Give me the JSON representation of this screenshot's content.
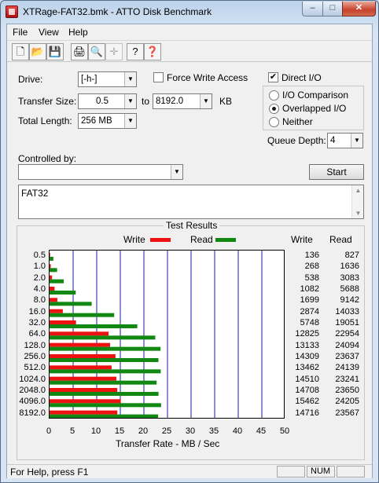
{
  "window": {
    "title": "XTRage-FAT32.bmk - ATTO Disk Benchmark",
    "min": "–",
    "max": "□",
    "close": "✕"
  },
  "menu": [
    "File",
    "View",
    "Help"
  ],
  "toolbar": [
    {
      "icon": "new-file-icon",
      "glyph": "🗋"
    },
    {
      "icon": "open-folder-icon",
      "glyph": "📂"
    },
    {
      "icon": "save-icon",
      "glyph": "💾"
    },
    {
      "icon": "print-icon",
      "glyph": "🖨"
    },
    {
      "icon": "print-preview-icon",
      "glyph": "🔍"
    },
    {
      "icon": "move-icon",
      "glyph": "✛"
    },
    {
      "icon": "help-icon",
      "glyph": "?"
    },
    {
      "icon": "context-help-icon",
      "glyph": "❓"
    }
  ],
  "form": {
    "drive_label": "Drive:",
    "drive_value": "[-h-]",
    "force_write_label": "Force Write Access",
    "force_write_checked": false,
    "direct_io_label": "Direct I/O",
    "direct_io_checked": true,
    "transfer_label": "Transfer Size:",
    "transfer_from": "0.5",
    "to_label": "to",
    "transfer_to": "8192.0",
    "kb_label": "KB",
    "total_length_label": "Total Length:",
    "total_length_value": "256 MB",
    "io_comparison": "I/O Comparison",
    "overlapped_io": "Overlapped I/O",
    "neither": "Neither",
    "selected_mode": "Overlapped I/O",
    "queue_depth_label": "Queue Depth:",
    "queue_depth_value": "4",
    "controlled_by_label": "Controlled by:",
    "controlled_by_value": "",
    "start_label": "Start",
    "description": "FAT32"
  },
  "results": {
    "title": "Test Results",
    "write_label": "Write",
    "read_label": "Read",
    "col_write": "Write",
    "col_read": "Read",
    "xlabel": "Transfer Rate - MB / Sec"
  },
  "chart_data": {
    "type": "bar",
    "title": "Test Results",
    "xlabel": "Transfer Rate - MB / Sec",
    "ylabel": "",
    "xlim": [
      0,
      50
    ],
    "x_ticks": [
      "0",
      "5",
      "10",
      "15",
      "20",
      "25",
      "30",
      "35",
      "40",
      "45",
      "50"
    ],
    "categories": [
      "0.5",
      "1.0",
      "2.0",
      "4.0",
      "8.0",
      "16.0",
      "32.0",
      "64.0",
      "128.0",
      "256.0",
      "512.0",
      "1024.0",
      "2048.0",
      "4096.0",
      "8192.0"
    ],
    "series": [
      {
        "name": "Write",
        "color": "#ee1111",
        "values": [
          0.13,
          0.26,
          0.53,
          1.06,
          1.66,
          2.81,
          5.61,
          12.52,
          12.83,
          13.97,
          13.15,
          14.17,
          14.36,
          15.1,
          14.37
        ]
      },
      {
        "name": "Read",
        "color": "#118811",
        "values": [
          0.81,
          1.6,
          3.01,
          5.55,
          8.93,
          13.7,
          18.6,
          22.42,
          23.53,
          23.08,
          23.57,
          22.7,
          23.1,
          23.64,
          23.01
        ]
      }
    ],
    "write_values_text": [
      "136",
      "268",
      "538",
      "1082",
      "1699",
      "2874",
      "5748",
      "12825",
      "13133",
      "14309",
      "13462",
      "14510",
      "14708",
      "15462",
      "14716"
    ],
    "read_values_text": [
      "827",
      "1636",
      "3083",
      "5688",
      "9142",
      "14033",
      "19051",
      "22954",
      "24094",
      "23637",
      "24139",
      "23241",
      "23650",
      "24205",
      "23567"
    ],
    "grid": true,
    "legend_placement": "top"
  },
  "status": {
    "text": "For Help, press F1",
    "num": "NUM"
  }
}
